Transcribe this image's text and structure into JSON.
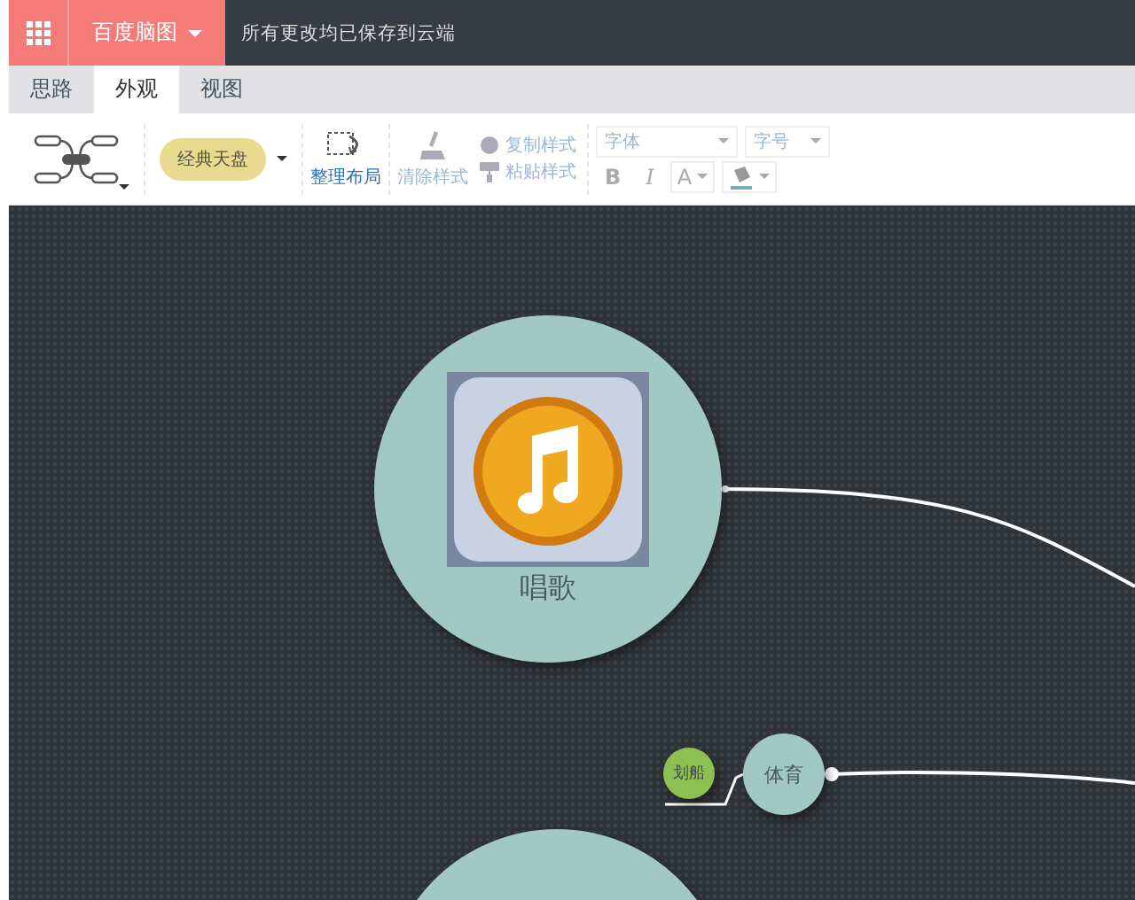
{
  "top_bar": {
    "app_name": "百度脑图",
    "status": "所有更改均已保存到云端"
  },
  "tabs": [
    {
      "label": "思路",
      "selected": false
    },
    {
      "label": "外观",
      "selected": true
    },
    {
      "label": "视图",
      "selected": false
    }
  ],
  "toolbar": {
    "theme": "经典天盘",
    "actions": [
      {
        "label": "整理布局",
        "disabled": false
      },
      {
        "label": "清除样式",
        "disabled": true
      }
    ],
    "style_actions": [
      {
        "label": "复制样式",
        "disabled": true
      },
      {
        "label": "粘贴样式",
        "disabled": true
      }
    ],
    "font_select": {
      "placeholder": "字体"
    },
    "size_select": {
      "placeholder": "字号"
    },
    "format_buttons": [
      {
        "label": "B",
        "kind": "bold"
      },
      {
        "label": "I",
        "kind": "italic"
      },
      {
        "label": "A",
        "kind": "color"
      }
    ]
  },
  "nodes": [
    {
      "kind": "image",
      "text": "唱歌"
    },
    {
      "kind": "small",
      "text": "体育"
    },
    {
      "kind": "tiny",
      "text": "划船",
      "color": "#8cc152"
    },
    {
      "kind": "partial"
    }
  ]
}
